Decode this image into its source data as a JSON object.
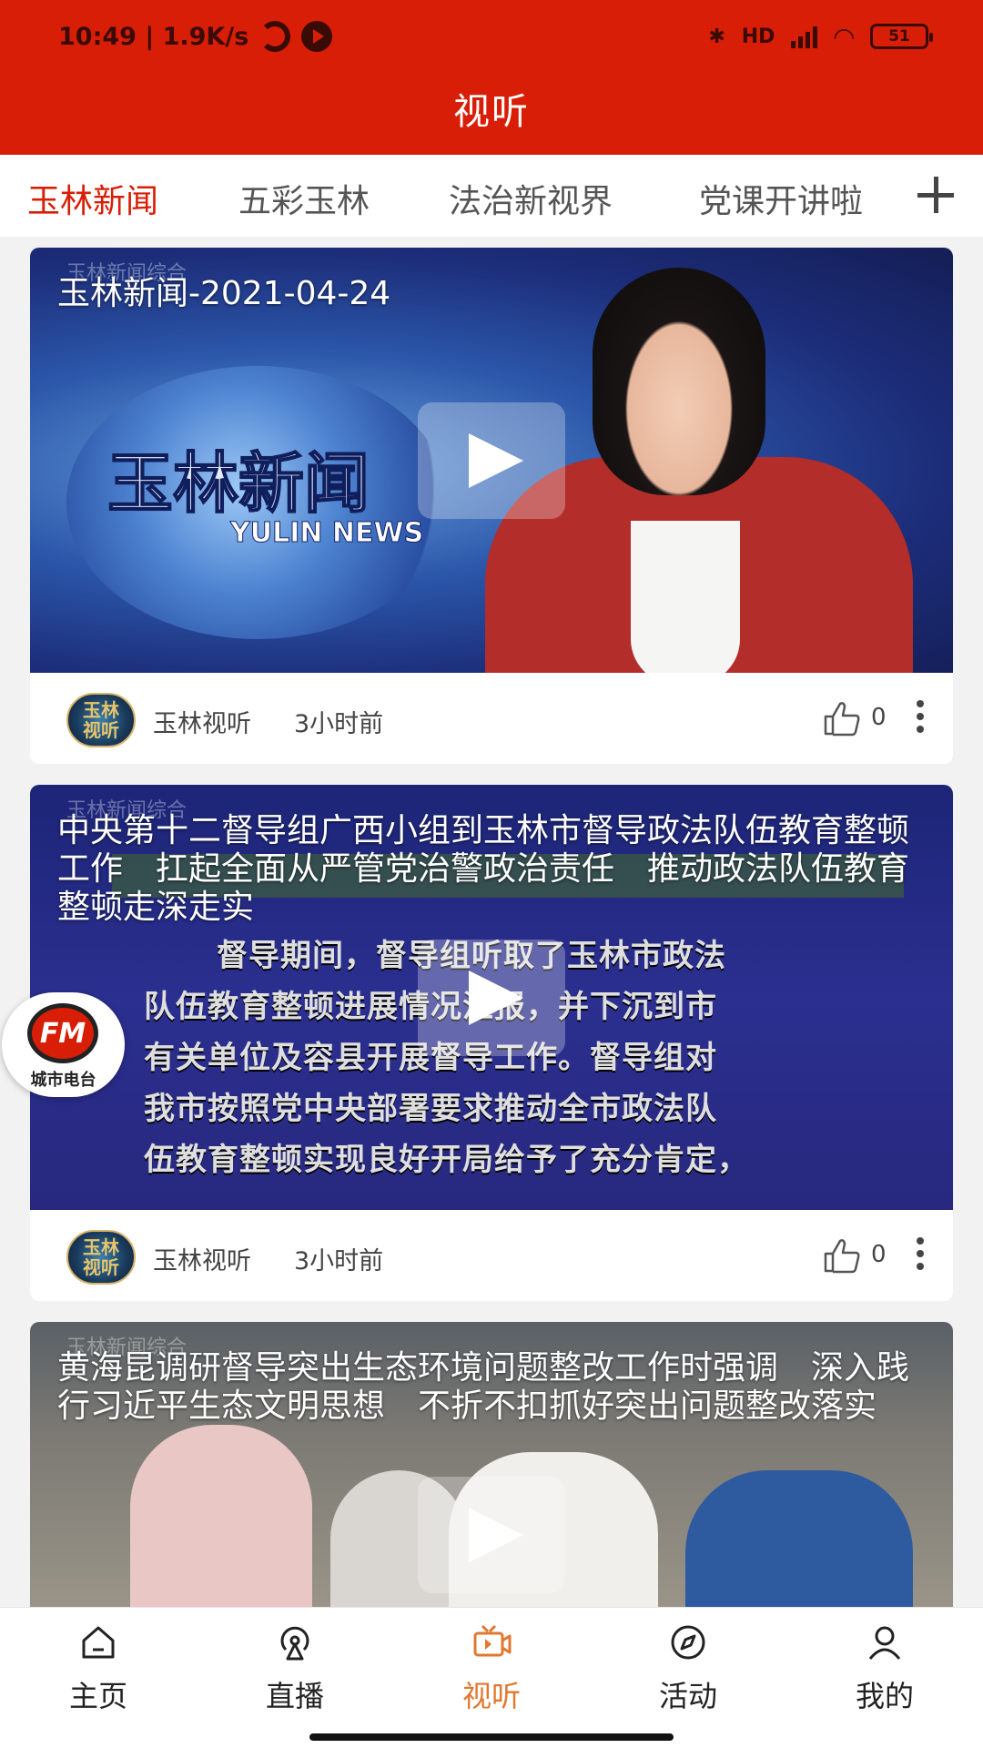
{
  "status_bar": {
    "time_speed": "10:49 | 1.9K/s",
    "network": "HD",
    "battery": "51"
  },
  "header": {
    "title": "视听"
  },
  "tabs": [
    {
      "label": "玉林新闻",
      "active": true
    },
    {
      "label": "五彩玉林",
      "active": false
    },
    {
      "label": "法治新视界",
      "active": false
    },
    {
      "label": "党课开讲啦",
      "active": false
    }
  ],
  "cards": [
    {
      "title": "玉林新闻-2021-04-24",
      "channel_mark": "玉林新闻综合",
      "logo_text": "玉林新闻",
      "logo_sub": "YULIN NEWS",
      "source": "玉林视听",
      "time": "3小时前",
      "likes": "0"
    },
    {
      "title": "中央第十二督导组广西小组到玉林市督导政法队伍教育整顿工作　扛起全面从严管党治警政治责任　推动政法队伍教育整顿走深走实",
      "channel_mark": "玉林新闻综合",
      "lines": [
        "督导期间，督导组听取了玉林市政法",
        "队伍教育整顿进展情况汇报，并下沉到市",
        "有关单位及容县开展督导工作。督导组对",
        "我市按照党中央部署要求推动全市政法队",
        "伍教育整顿实现良好开局给予了充分肯定，"
      ],
      "source": "玉林视听",
      "time": "3小时前",
      "likes": "0"
    },
    {
      "title": "黄海昆调研督导突出生态环境问题整改工作时强调　深入践行习近平生态文明思想　不折不扣抓好突出问题整改落实",
      "channel_mark": "玉林新闻综合"
    }
  ],
  "avatar_text": "玉林视听",
  "fm": {
    "badge": "FM",
    "label": "城市电台"
  },
  "bottom_nav": [
    {
      "label": "主页",
      "icon": "home-icon",
      "active": false
    },
    {
      "label": "直播",
      "icon": "live-icon",
      "active": false
    },
    {
      "label": "视听",
      "icon": "tv-icon",
      "active": true
    },
    {
      "label": "活动",
      "icon": "compass-icon",
      "active": false
    },
    {
      "label": "我的",
      "icon": "user-icon",
      "active": false
    }
  ],
  "colors": {
    "brand_red": "#d81e06",
    "active_nav": "#e0782f"
  }
}
